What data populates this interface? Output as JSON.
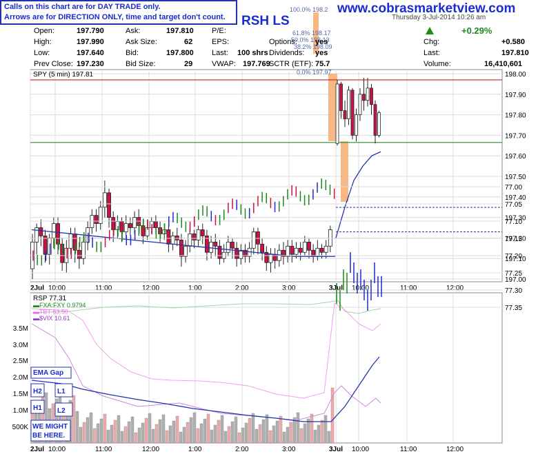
{
  "notice": {
    "line1": "Calls on this chart are for DAY TRADE only.",
    "line2": "Arrows are for DIRECTION ONLY, time and target don't count."
  },
  "site": "www.cobrasmarketview.com",
  "symbol_label": "RSH LS",
  "date": "Thursday 3-Jul-2014 10:26 am",
  "quote": {
    "open_label": "Open:",
    "open": "197.790",
    "high_label": "High:",
    "high": "197.990",
    "low_label": "Low:",
    "low": "197.640",
    "prev_label": "Prev Close:",
    "prev": "197.230",
    "ask_label": "Ask:",
    "ask": "197.810",
    "asksize_label": "Ask Size:",
    "asksize": "62",
    "bid_label": "Bid:",
    "bid": "197.800",
    "bidsize_label": "Bid Size:",
    "bidsize": "29",
    "pe_label": "P/E:",
    "eps_label": "EPS:",
    "last_label": "Last:",
    "last_shares": "100 shrs",
    "vwap_label": "VWAP:",
    "vwap": "197.769",
    "options_label": "Options:",
    "options": "yes",
    "dividends_label": "Dividends:",
    "dividends": "yes",
    "sctr_label": "SCTR (ETF):",
    "sctr": "75.7",
    "pct_change": "+0.29%",
    "chg_label": "Chg:",
    "chg": "+0.580",
    "last2_label": "Last:",
    "last2": "197.810",
    "volume_label": "Volume:",
    "volume": "16,410,601"
  },
  "colors": {
    "up": "#1b8a1b",
    "down": "#cc1144",
    "ma": "#2233aa",
    "blue_bar": "#1a2bd0",
    "fib": "#f5b078",
    "grid": "#dcdcdc",
    "resistance": "#cc2222",
    "support": "#2e8b2e",
    "fxa": "#1b8a1b",
    "tbt": "#ee66ee",
    "vix": "#9933cc",
    "vol_up": "#b0b0b0",
    "vol_down": "#f0aaaa"
  },
  "chart_data": [
    {
      "type": "candlestick",
      "title": "SPY (5 min) 197.81",
      "ylim": [
        196.95,
        198.0
      ],
      "y_ticks": [
        "198.00",
        "197.90",
        "197.80",
        "197.70",
        "197.60",
        "197.50",
        "197.40",
        "197.30",
        "197.20",
        "197.10",
        "197.00"
      ],
      "x_ticks": [
        "2Jul",
        "10:00",
        "11:00",
        "12:00",
        "1:00",
        "2:00",
        "3:00",
        "3Jul",
        "10:00",
        "11:00",
        "12:00"
      ],
      "fib_labels": [
        "100.0% 198.2",
        "61.8% 198.17",
        "50.0% 198.13",
        "38.2% 198.09",
        "0.0% 197.97"
      ],
      "resistance": 197.97,
      "support": 197.665,
      "prior_close_line": 197.23,
      "candles_day1": [
        [
          197.05,
          197.18,
          197.0,
          197.22
        ],
        [
          197.18,
          197.25,
          197.12,
          197.27
        ],
        [
          197.25,
          197.21,
          197.16,
          197.29
        ],
        [
          197.21,
          197.12,
          197.08,
          197.24
        ],
        [
          197.12,
          197.2,
          197.07,
          197.22
        ],
        [
          197.2,
          197.27,
          197.15,
          197.3
        ],
        [
          197.27,
          197.17,
          197.12,
          197.3
        ],
        [
          197.17,
          197.08,
          197.04,
          197.2
        ],
        [
          197.08,
          197.15,
          197.03,
          197.19
        ],
        [
          197.15,
          197.22,
          197.12,
          197.25
        ],
        [
          197.22,
          197.14,
          197.08,
          197.25
        ],
        [
          197.14,
          197.1,
          197.05,
          197.18
        ],
        [
          197.1,
          197.18,
          197.07,
          197.21
        ],
        [
          197.18,
          197.25,
          197.14,
          197.28
        ],
        [
          197.25,
          197.31,
          197.22,
          197.34
        ],
        [
          197.31,
          197.27,
          197.23,
          197.34
        ],
        [
          197.27,
          197.35,
          197.24,
          197.38
        ],
        [
          197.35,
          197.42,
          197.3,
          197.48
        ],
        [
          197.42,
          197.3,
          197.25,
          197.44
        ],
        [
          197.3,
          197.24,
          197.18,
          197.33
        ],
        [
          197.24,
          197.28,
          197.2,
          197.31
        ],
        [
          197.28,
          197.23,
          197.18,
          197.3
        ],
        [
          197.23,
          197.27,
          197.2,
          197.31
        ],
        [
          197.27,
          197.25,
          197.21,
          197.3
        ],
        [
          197.25,
          197.3,
          197.22,
          197.33
        ],
        [
          197.3,
          197.26,
          197.21,
          197.34
        ],
        [
          197.26,
          197.21,
          197.17,
          197.29
        ],
        [
          197.21,
          197.25,
          197.19,
          197.29
        ],
        [
          197.25,
          197.28,
          197.22,
          197.3
        ],
        [
          197.28,
          197.25,
          197.22,
          197.31
        ],
        [
          197.25,
          197.22,
          197.18,
          197.28
        ],
        [
          197.22,
          197.24,
          197.19,
          197.27
        ],
        [
          197.24,
          197.17,
          197.13,
          197.26
        ],
        [
          197.17,
          197.21,
          197.14,
          197.23
        ],
        [
          197.21,
          197.19,
          197.16,
          197.25
        ],
        [
          197.19,
          197.11,
          197.06,
          197.22
        ],
        [
          197.11,
          197.16,
          197.08,
          197.19
        ],
        [
          197.16,
          197.22,
          197.13,
          197.25
        ],
        [
          197.22,
          197.19,
          197.15,
          197.24
        ],
        [
          197.19,
          197.24,
          197.16,
          197.26
        ],
        [
          197.24,
          197.21,
          197.17,
          197.27
        ],
        [
          197.21,
          197.13,
          197.09,
          197.24
        ],
        [
          197.13,
          197.18,
          197.1,
          197.21
        ],
        [
          197.18,
          197.16,
          197.11,
          197.22
        ],
        [
          197.16,
          197.1,
          197.07,
          197.19
        ],
        [
          197.1,
          197.13,
          197.08,
          197.17
        ],
        [
          197.13,
          197.18,
          197.11,
          197.21
        ],
        [
          197.18,
          197.15,
          197.1,
          197.2
        ],
        [
          197.15,
          197.1,
          197.06,
          197.18
        ],
        [
          197.1,
          197.14,
          197.07,
          197.17
        ],
        [
          197.14,
          197.11,
          197.08,
          197.17
        ],
        [
          197.11,
          197.15,
          197.08,
          197.18
        ],
        [
          197.15,
          197.23,
          197.12,
          197.25
        ],
        [
          197.23,
          197.17,
          197.12,
          197.25
        ],
        [
          197.17,
          197.13,
          197.09,
          197.2
        ],
        [
          197.13,
          197.08,
          197.04,
          197.16
        ],
        [
          197.08,
          197.12,
          197.03,
          197.15
        ],
        [
          197.12,
          197.09,
          197.05,
          197.15
        ],
        [
          197.09,
          197.14,
          197.06,
          197.17
        ],
        [
          197.14,
          197.11,
          197.07,
          197.18
        ],
        [
          197.11,
          197.16,
          197.08,
          197.19
        ],
        [
          197.16,
          197.12,
          197.08,
          197.19
        ],
        [
          197.12,
          197.15,
          197.1,
          197.18
        ],
        [
          197.15,
          197.13,
          197.09,
          197.18
        ],
        [
          197.13,
          197.18,
          197.11,
          197.21
        ],
        [
          197.18,
          197.14,
          197.1,
          197.2
        ],
        [
          197.14,
          197.11,
          197.08,
          197.17
        ],
        [
          197.11,
          197.15,
          197.09,
          197.19
        ],
        [
          197.15,
          197.13,
          197.1,
          197.17
        ],
        [
          197.13,
          197.16,
          197.1,
          197.19
        ],
        [
          197.16,
          197.24,
          197.13,
          197.26
        ]
      ],
      "candles_day2": [
        [
          197.66,
          197.95,
          197.65,
          197.97
        ],
        [
          197.95,
          197.82,
          197.78,
          197.96
        ],
        [
          197.82,
          197.78,
          197.74,
          197.87
        ],
        [
          197.78,
          197.92,
          197.75,
          197.94
        ],
        [
          197.92,
          197.7,
          197.68,
          197.93
        ],
        [
          197.7,
          197.8,
          197.67,
          197.83
        ],
        [
          197.8,
          197.9,
          197.77,
          197.93
        ],
        [
          197.9,
          197.87,
          197.82,
          197.98
        ],
        [
          197.87,
          197.93,
          197.84,
          197.98
        ],
        [
          197.93,
          197.85,
          197.8,
          197.95
        ],
        [
          197.85,
          197.7,
          197.66,
          197.87
        ],
        [
          197.7,
          197.81,
          197.69,
          197.82
        ]
      ],
      "ma_day1": [
        197.24,
        197.23,
        197.22,
        197.21,
        197.2,
        197.19,
        197.18,
        197.17,
        197.16,
        197.15,
        197.14,
        197.13,
        197.12,
        197.11,
        197.11,
        197.11
      ],
      "ma_day2": [
        197.2,
        197.35,
        197.48,
        197.55,
        197.6,
        197.62
      ],
      "y_format_note": ""
    },
    {
      "type": "line",
      "title": "RSP 77.31",
      "series_labels": [
        "FXA:FXY 0.9794",
        "TBT 63.50",
        "$VIX 10.61"
      ],
      "y_ticks_right": [
        "77.35",
        "77.30",
        "77.25",
        "77.20",
        "77.15",
        "77.10",
        "77.05",
        "77.00"
      ],
      "y_ticks_left": [
        "3.5M",
        "3.0M",
        "2.5M",
        "2.0M",
        "1.5M",
        "1.0M",
        "500K"
      ],
      "x_ticks": [
        "2Jul",
        "10:00",
        "11:00",
        "12:00",
        "1:00",
        "2:00",
        "3:00",
        "3Jul",
        "10:00",
        "11:00",
        "12:00"
      ],
      "dotted_line": 77.06,
      "annotations": [
        "EMA Gap",
        "H2",
        "L1",
        "H1",
        "L2",
        "WE MIGHT BE HERE."
      ]
    }
  ]
}
